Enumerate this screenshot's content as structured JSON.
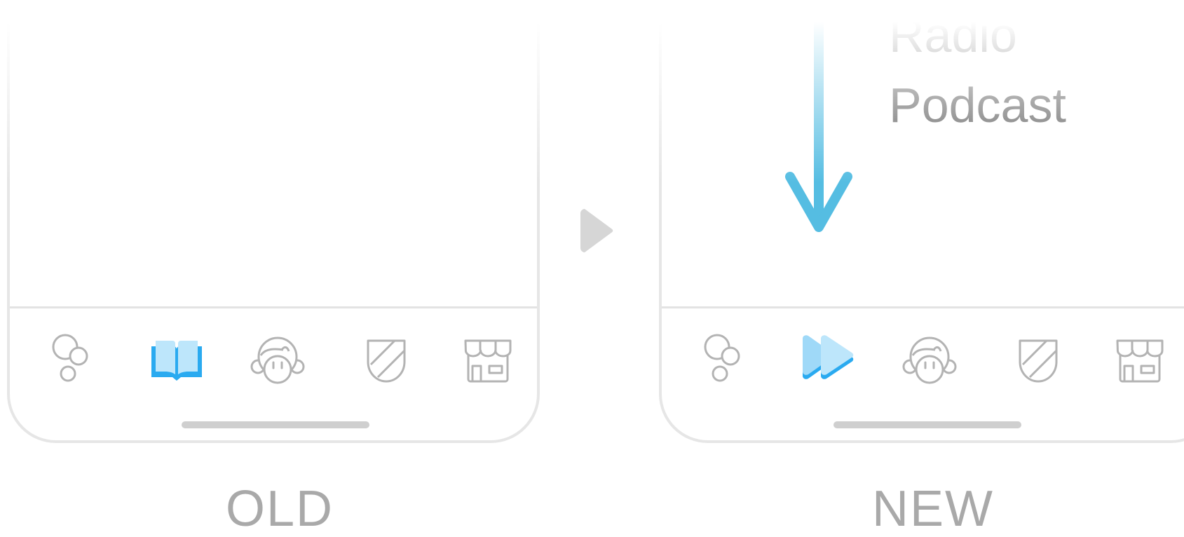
{
  "labels": {
    "old": "OLD",
    "new": "NEW"
  },
  "rename": {
    "line1": "Radio",
    "line2": "Podcast"
  },
  "colors": {
    "accent_blue": "#2aaaf0",
    "accent_light": "#bde6fb",
    "arrow_blue": "#55bde2",
    "icon_gray": "#b3b3b3",
    "caption_gray": "#a9a9a9",
    "text_dark": "#555555"
  },
  "old_tabs": [
    {
      "icon": "bubbles-icon",
      "selected": false
    },
    {
      "icon": "open-book-icon",
      "selected": true
    },
    {
      "icon": "character-face-icon",
      "selected": false
    },
    {
      "icon": "shield-icon",
      "selected": false
    },
    {
      "icon": "shop-icon",
      "selected": false
    }
  ],
  "new_tabs": [
    {
      "icon": "bubbles-icon",
      "selected": false
    },
    {
      "icon": "fast-forward-icon",
      "selected": true
    },
    {
      "icon": "character-face-icon",
      "selected": false
    },
    {
      "icon": "shield-icon",
      "selected": false
    },
    {
      "icon": "shop-icon",
      "selected": false
    }
  ]
}
